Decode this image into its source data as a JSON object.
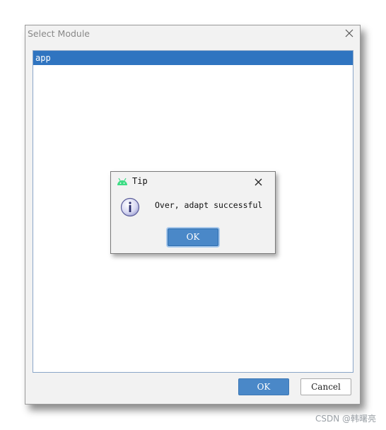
{
  "dialog": {
    "title": "Select Module",
    "modules": [
      {
        "label": "app",
        "selected": true
      }
    ],
    "ok_label": "OK",
    "cancel_label": "Cancel"
  },
  "tip": {
    "title": "Tip",
    "message": "Over, adapt successful",
    "ok_label": "OK",
    "title_icon": "android-icon",
    "message_icon": "info-icon"
  },
  "watermark": "CSDN @韩曙亮",
  "colors": {
    "selection": "#2f74c0",
    "button_primary": "#4a88c8",
    "android_green": "#3ddc84"
  }
}
